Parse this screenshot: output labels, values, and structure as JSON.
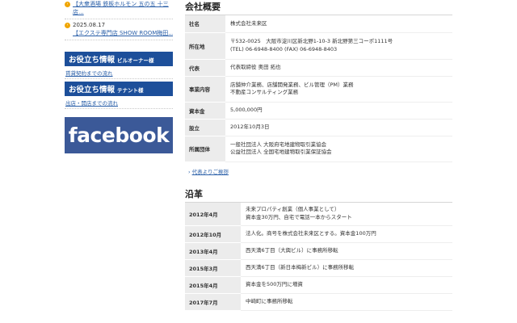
{
  "sidebar": {
    "news": [
      {
        "date": "",
        "title": "【大衆酒場 鉄板ホルモン 五の五 十三店..."
      },
      {
        "date": "2025.08.17",
        "title": "【エクステ専門店 SHOW ROOM梅田..."
      }
    ],
    "info_owner": {
      "title": "お役立ち情報",
      "sub": "ビルオーナー様",
      "link": "賃貸契約までの流れ"
    },
    "info_tenant": {
      "title": "お役立ち情報",
      "sub": "テナント様",
      "link": "出店・開店までの流れ"
    },
    "facebook_label": "facebook"
  },
  "company": {
    "title": "会社概要",
    "rows": [
      {
        "label": "社名",
        "value": [
          "株式会社未来区"
        ]
      },
      {
        "label": "所在地",
        "value": [
          "〒532-0025　大阪市淀川区新北野1-10-3 新北野第三コーポ1111号",
          "(TEL) 06-6948-8400 (FAX) 06-6948-8403"
        ]
      },
      {
        "label": "代表",
        "value": [
          "代表取締役 奥田 拓也"
        ]
      },
      {
        "label": "事業内容",
        "value": [
          "店舗仲介業務、店舗開発業務、ビル管理（PM）業務",
          "不動産コンサルティング業務"
        ]
      },
      {
        "label": "資本金",
        "value": [
          "5,000,000円"
        ]
      },
      {
        "label": "設立",
        "value": [
          "2012年10月3日"
        ]
      },
      {
        "label": "所属団体",
        "value": [
          "一般社団法人 大阪府宅地建物取引業協会",
          "公益社団法人 全国宅地建物取引業保証協会"
        ]
      }
    ],
    "greeting_link": "代表よりご挨拶"
  },
  "history": {
    "title": "沿革",
    "rows": [
      {
        "date": "2012年4月",
        "text": [
          "未来プロパティ創業（個人事業として）",
          "資本金30万円、自宅で電話一本からスタート"
        ]
      },
      {
        "date": "2012年10月",
        "text": [
          "法人化。商号を株式会社未来区とする。資本金100万円"
        ]
      },
      {
        "date": "2013年4月",
        "text": [
          "西天満6丁目（大興ビル）に事務所移転"
        ]
      },
      {
        "date": "2015年3月",
        "text": [
          "西天満6丁目（新日本梅新ビル）に事務所移転"
        ]
      },
      {
        "date": "2015年4月",
        "text": [
          "資本金を500万円に増資"
        ]
      },
      {
        "date": "2017年7月",
        "text": [
          "中崎町に事務所移転"
        ]
      }
    ]
  }
}
